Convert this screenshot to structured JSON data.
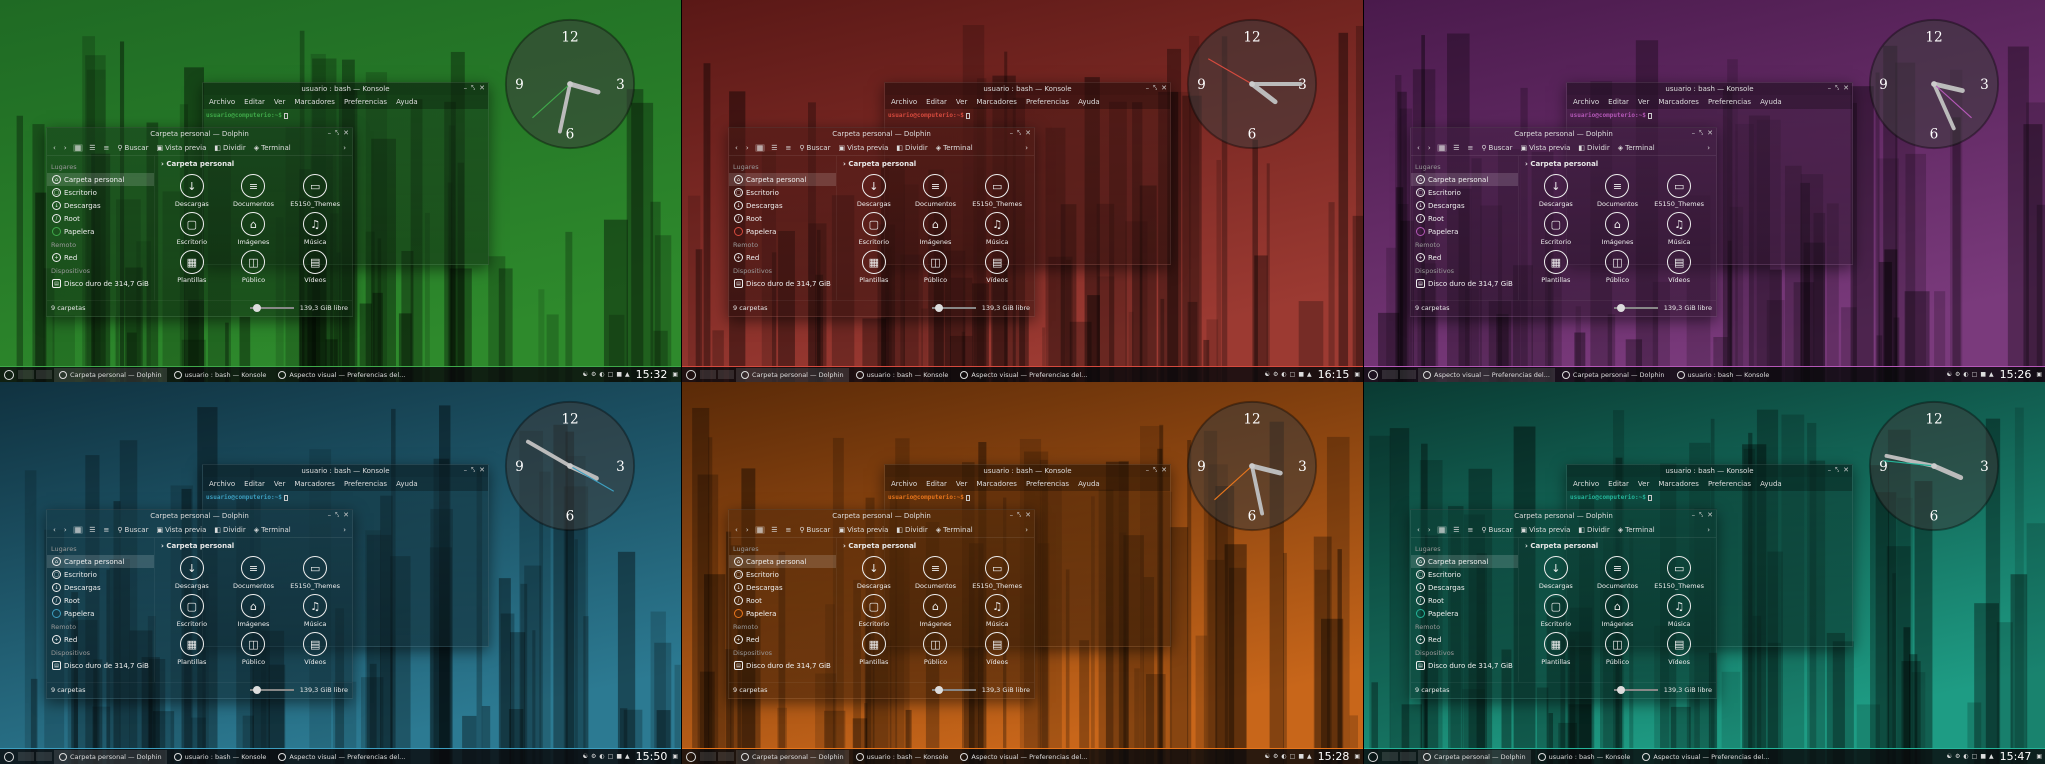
{
  "konsole": {
    "title": "usuario : bash — Konsole",
    "menu": [
      "Archivo",
      "Editar",
      "Ver",
      "Marcadores",
      "Preferencias",
      "Ayuda"
    ],
    "prompt": "usuario@computerio:~$"
  },
  "dolphin": {
    "title": "Carpeta personal — Dolphin",
    "toolbar": {
      "search": "Buscar",
      "preview": "Vista previa",
      "split": "Dividir",
      "terminal": "Terminal"
    },
    "places_header": "Lugares",
    "places": [
      "Carpeta personal",
      "Escritorio",
      "Descargas",
      "Root",
      "Papelera"
    ],
    "remote_header": "Remoto",
    "remote": [
      "Red"
    ],
    "devices_header": "Dispositivos",
    "devices": [
      "Disco duro de 314,7 GiB"
    ],
    "breadcrumb": "Carpeta personal",
    "folders": [
      {
        "name": "Descargas",
        "icon": "download-icon"
      },
      {
        "name": "Documentos",
        "icon": "document-icon"
      },
      {
        "name": "E5150_Themes",
        "icon": "folder-icon"
      },
      {
        "name": "Escritorio",
        "icon": "desktop-icon"
      },
      {
        "name": "Imágenes",
        "icon": "image-icon"
      },
      {
        "name": "Música",
        "icon": "music-icon"
      },
      {
        "name": "Plantillas",
        "icon": "template-icon"
      },
      {
        "name": "Público",
        "icon": "public-icon"
      },
      {
        "name": "Vídeos",
        "icon": "video-icon"
      }
    ],
    "status_count": "9 carpetas",
    "status_free": "139,3 GiB libre"
  },
  "tasks": {
    "dolphin": "Carpeta personal — Dolphin",
    "konsole": "usuario : bash — Konsole",
    "prefs": "Aspecto visual — Preferencias del..."
  },
  "screens": [
    {
      "theme": "green",
      "accent": "#3fa94a",
      "bg_top": "#1f6a24",
      "bg_bottom": "#2e8a2c",
      "time": "15:32",
      "order": [
        "dolphin",
        "konsole",
        "prefs"
      ],
      "hands": {
        "hour": 3,
        "minute": 32,
        "second": 38
      }
    },
    {
      "theme": "red",
      "accent": "#d64a3e",
      "bg_top": "#5a1816",
      "bg_bottom": "#9c3a32",
      "time": "16:15",
      "order": [
        "dolphin",
        "konsole",
        "prefs"
      ],
      "hands": {
        "hour": 4,
        "minute": 15,
        "second": 50
      }
    },
    {
      "theme": "purple",
      "accent": "#b558b8",
      "bg_top": "#4a1a4c",
      "bg_bottom": "#7a3a7c",
      "time": "15:26",
      "order": [
        "prefs",
        "dolphin",
        "konsole"
      ],
      "hands": {
        "hour": 3,
        "minute": 26,
        "second": 22
      }
    },
    {
      "theme": "blue",
      "accent": "#3d9fc0",
      "bg_top": "#103240",
      "bg_bottom": "#2c7a92",
      "time": "15:50",
      "order": [
        "dolphin",
        "konsole",
        "prefs"
      ],
      "hands": {
        "hour": 3,
        "minute": 50,
        "second": 20
      }
    },
    {
      "theme": "orange",
      "accent": "#e8761c",
      "bg_top": "#5a2a08",
      "bg_bottom": "#c8661a",
      "time": "15:28",
      "order": [
        "dolphin",
        "konsole",
        "prefs"
      ],
      "hands": {
        "hour": 3,
        "minute": 28,
        "second": 38
      }
    },
    {
      "theme": "teal",
      "accent": "#25b59a",
      "bg_top": "#0a3a32",
      "bg_bottom": "#1e9c84",
      "time": "15:47",
      "order": [
        "dolphin",
        "konsole",
        "prefs"
      ],
      "hands": {
        "hour": 3,
        "minute": 47,
        "second": 46
      }
    }
  ]
}
